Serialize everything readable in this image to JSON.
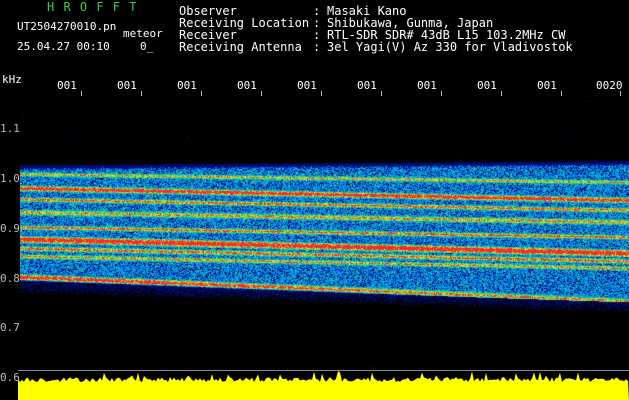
{
  "header": {
    "app_title": "H R O F F T",
    "file_name": "UT2504270010.pn",
    "meteor_label": "meteor",
    "timestamp": "25.04.27 00:10",
    "count": "0_"
  },
  "info": [
    {
      "label": "Observer",
      "value": "Masaki Kano"
    },
    {
      "label": "Receiving Location",
      "value": "Shibukawa, Gunma, Japan"
    },
    {
      "label": "Receiver",
      "value": "RTL-SDR SDR# 43dB L15 103.2MHz CW"
    },
    {
      "label": "Receiving Antenna",
      "value": "3el Yagi(V) Az 330 for Vladivostok"
    }
  ],
  "axis": {
    "unit": "kHz",
    "time_ticks": [
      "001",
      "001",
      "001",
      "001",
      "001",
      "001",
      "001",
      "001",
      "001",
      "0020"
    ],
    "freq_ticks": [
      "1.1",
      "1.0",
      "0.9",
      "0.8",
      "0.7",
      "0.6"
    ]
  },
  "colors": {
    "background": "#000000",
    "title_green": "#2fd24a",
    "time_tick": "#ffffff",
    "level_bar": "#ffff00",
    "signal_low": "#0a1a8f",
    "signal_mid": "#00c8ff",
    "signal_high": "#ff3030"
  }
}
